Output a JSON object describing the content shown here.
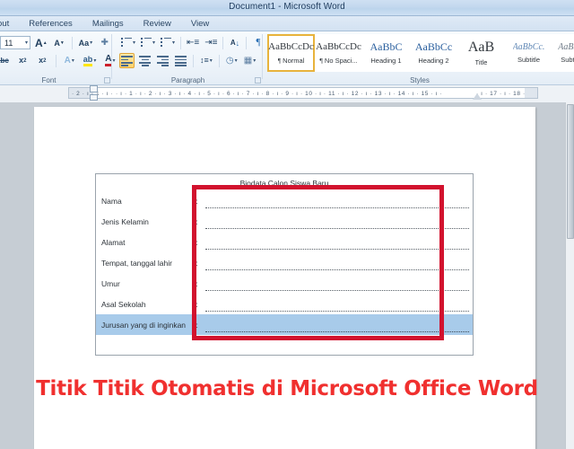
{
  "window": {
    "title": "Document1  -  Microsoft Word"
  },
  "tabs": [
    {
      "label": "out",
      "name": "tab-page-layout"
    },
    {
      "label": "References",
      "name": "tab-references"
    },
    {
      "label": "Mailings",
      "name": "tab-mailings"
    },
    {
      "label": "Review",
      "name": "tab-review"
    },
    {
      "label": "View",
      "name": "tab-view"
    }
  ],
  "ribbon": {
    "font_group": {
      "label": "Font",
      "font_size": "11",
      "grow_font": "A",
      "shrink_font": "A",
      "change_case": "Aa",
      "clear_formatting": "✐",
      "strikethrough": "abc",
      "subscript": "x₂",
      "superscript": "x²",
      "text_effects": "A",
      "highlight": "ab",
      "font_color": "A"
    },
    "paragraph_group": {
      "label": "Paragraph",
      "bullets": "bullets",
      "numbering": "numbering",
      "multilevel": "multilevel-list",
      "decrease_indent": "≡",
      "increase_indent": "≡",
      "sort": "A↓",
      "show_marks": "¶",
      "align_left": "align-left",
      "align_center": "align-center",
      "align_right": "align-right",
      "justify": "justify",
      "line_spacing": "line-spacing",
      "shading": "shading",
      "borders": "borders"
    },
    "styles_group": {
      "label": "Styles",
      "items": [
        {
          "preview": "AaBbCcDc",
          "name": "Normal",
          "pilcrow": true,
          "selected": true
        },
        {
          "preview": "AaBbCcDc",
          "name": "No Spaci...",
          "pilcrow": true,
          "selected": false
        },
        {
          "preview": "AaBbC",
          "name": "Heading 1",
          "pilcrow": false,
          "selected": false
        },
        {
          "preview": "AaBbCc",
          "name": "Heading 2",
          "pilcrow": false,
          "selected": false
        },
        {
          "preview": "AaB",
          "name": "Title",
          "pilcrow": false,
          "selected": false
        },
        {
          "preview": "AaBbCc.",
          "name": "Subtitle",
          "pilcrow": false,
          "selected": false
        },
        {
          "preview": "AaBbCcD",
          "name": "Subtle Em",
          "pilcrow": false,
          "selected": false
        }
      ]
    }
  },
  "ruler": {
    "left_ticks": "· 2 · ı · 1 · ı ·",
    "ticks": "· ı · 1 · ı · 2 · ı · 3 · ı · 4 · ı · 5 · ı · 6 · ı · 7 · ı · 8 · ı · 9 · ı · 10 · ı · 11 · ı · 12 · ı · 13 · ı · 14 · ı · 15 · ı ·"
  },
  "ruler_right": {
    "ticks": "· ı · 17 · ı · 18 ·"
  },
  "document": {
    "heading": "Biodata Calon Siswa Baru",
    "colon": ":",
    "rows": [
      {
        "label": "Nama",
        "selected": false
      },
      {
        "label": "Jenis Kelamin",
        "selected": false
      },
      {
        "label": "Alamat",
        "selected": false
      },
      {
        "label": "Tempat, tanggal lahir",
        "selected": false
      },
      {
        "label": "Umur",
        "selected": false
      },
      {
        "label": "Asal Sekolah",
        "selected": false
      },
      {
        "label": "Jurusan yang di inginkan",
        "selected": true
      }
    ]
  },
  "annotation": {
    "caption": "Titik Titik Otomatis di Microsoft Office Word",
    "box_color": "#d2122e",
    "caption_color": "#f0302f",
    "selection_color": "#a8cbea"
  }
}
